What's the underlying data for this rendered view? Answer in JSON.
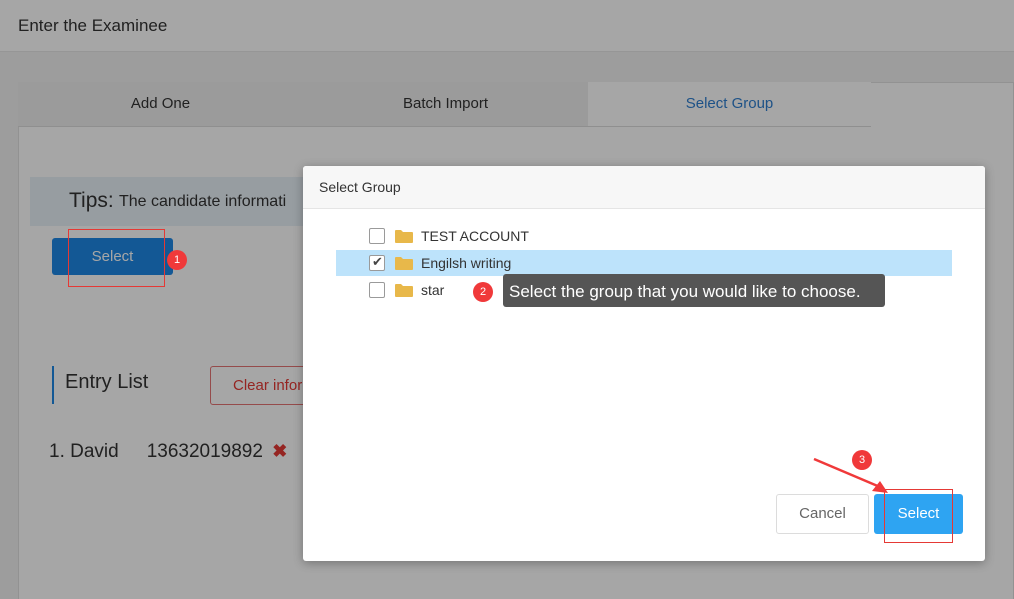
{
  "page": {
    "title": "Enter the Examinee"
  },
  "tabs": [
    {
      "label": "Add One"
    },
    {
      "label": "Batch Import"
    },
    {
      "label": "Select Group"
    }
  ],
  "tips": {
    "label": "Tips:",
    "text": "The candidate informati"
  },
  "main": {
    "select_label": "Select",
    "entry_list_title": "Entry List",
    "clear_label": "Clear infor",
    "entries": [
      {
        "name": "1. David",
        "phone": "13632019892",
        "remove_icon": "close-icon"
      }
    ]
  },
  "modal": {
    "title": "Select Group",
    "items": [
      {
        "label": "TEST ACCOUNT",
        "checked": false
      },
      {
        "label": "Engilsh writing",
        "checked": true
      },
      {
        "label": "star",
        "checked": false
      }
    ],
    "tooltip": "Select the group that you would like to choose.",
    "cancel_label": "Cancel",
    "select_label": "Select"
  },
  "annotations": {
    "step1": "1",
    "step2": "2",
    "step3": "3"
  },
  "colors": {
    "primary": "#2ea4f2",
    "annotation_red": "#f0393a",
    "selected_row": "#bde3fb",
    "folder": "#e8b84a"
  }
}
